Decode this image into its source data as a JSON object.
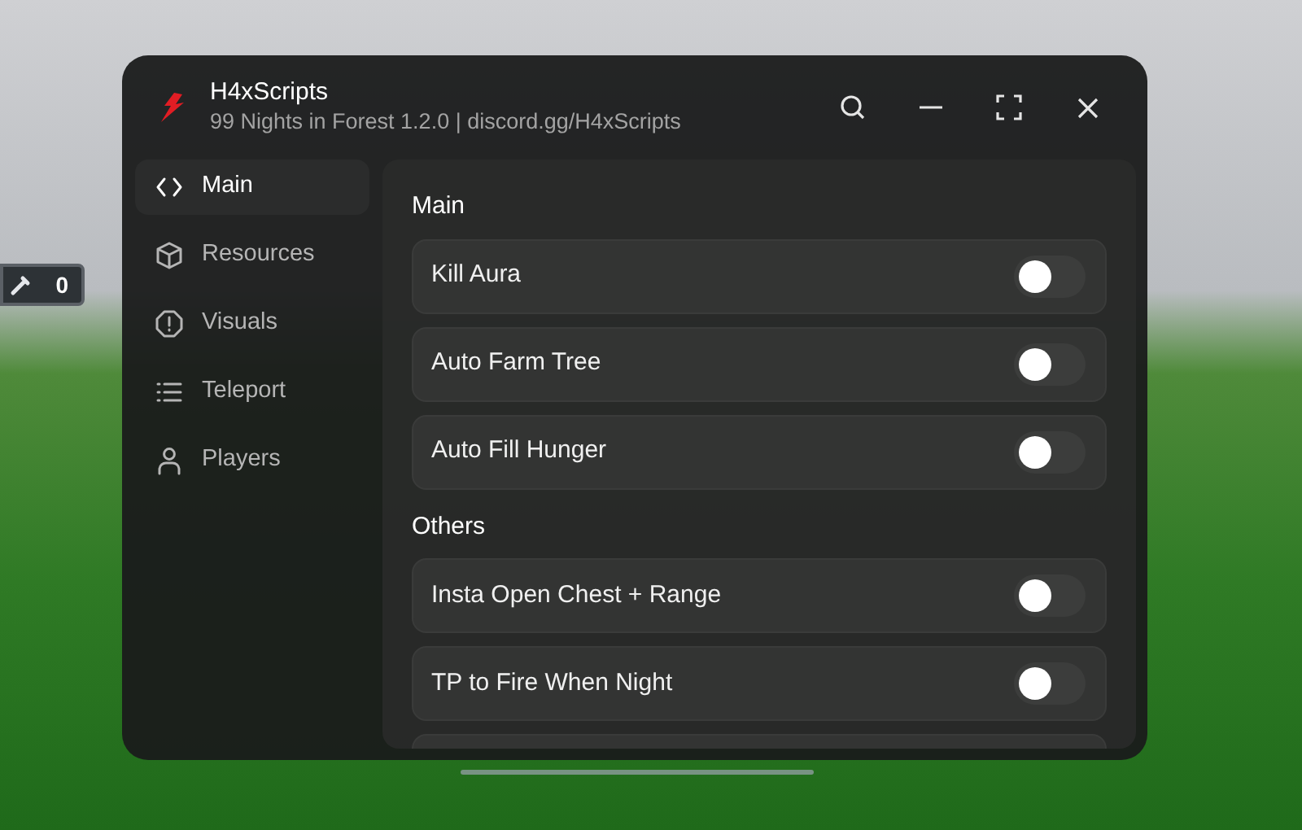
{
  "hud": {
    "counter": "0"
  },
  "window": {
    "title": "H4xScripts",
    "subtitle": "99 Nights in Forest 1.2.0 | discord.gg/H4xScripts"
  },
  "sidebar": {
    "items": [
      {
        "label": "Main",
        "selected": true
      },
      {
        "label": "Resources",
        "selected": false
      },
      {
        "label": "Visuals",
        "selected": false
      },
      {
        "label": "Teleport",
        "selected": false
      },
      {
        "label": "Players",
        "selected": false
      }
    ]
  },
  "sections": [
    {
      "title": "Main",
      "rows": [
        {
          "label": "Kill Aura",
          "on": false
        },
        {
          "label": "Auto Farm Tree",
          "on": false
        },
        {
          "label": "Auto Fill Hunger",
          "on": false
        }
      ]
    },
    {
      "title": "Others",
      "rows": [
        {
          "label": "Insta Open Chest + Range",
          "on": false
        },
        {
          "label": "TP to Fire When Night",
          "on": false
        }
      ]
    }
  ]
}
